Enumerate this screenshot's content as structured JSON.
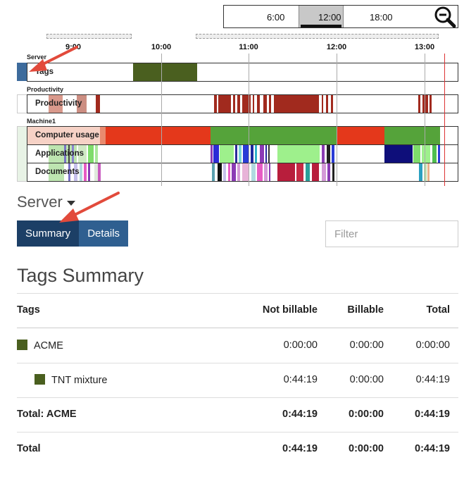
{
  "overview": {
    "labels": [
      "6:00",
      "12:00",
      "18:00"
    ]
  },
  "timeline": {
    "hours": [
      "9:00",
      "10:00",
      "11:00",
      "12:00",
      "13:00"
    ],
    "groups": {
      "server": "Server",
      "productivity": "Productivity",
      "machine": "Machine1"
    },
    "tracks": {
      "tags": "Tags",
      "productivity": "Productivity",
      "computer_usage": "Computer usage",
      "applications": "Applications",
      "documents": "Documents"
    }
  },
  "server_selector": {
    "label": "Server"
  },
  "tabs": {
    "summary": "Summary",
    "details": "Details"
  },
  "filter": {
    "placeholder": "Filter"
  },
  "summary": {
    "title": "Tags Summary",
    "headers": {
      "tags": "Tags",
      "not_billable": "Not billable",
      "billable": "Billable",
      "total": "Total"
    },
    "rows": [
      {
        "name": "ACME",
        "not_billable": "0:00:00",
        "billable": "0:00:00",
        "total": "0:00:00",
        "color": "#4a5f1f"
      },
      {
        "name": "TNT mixture",
        "not_billable": "0:44:19",
        "billable": "0:00:00",
        "total": "0:44:19",
        "color": "#4a5f1f"
      }
    ],
    "group_total": {
      "label": "Total: ACME",
      "not_billable": "0:44:19",
      "billable": "0:00:00",
      "total": "0:44:19"
    },
    "grand_total": {
      "label": "Total",
      "not_billable": "0:44:19",
      "billable": "0:00:00",
      "total": "0:44:19"
    }
  },
  "colors": {
    "tag_green": "#4a5f1f",
    "productive_red": "#a12a1e",
    "active_orange": "#e4381b",
    "active_green": "#55a33a",
    "tab_active": "#1c3f66",
    "tab_inactive": "#2f5f90"
  }
}
